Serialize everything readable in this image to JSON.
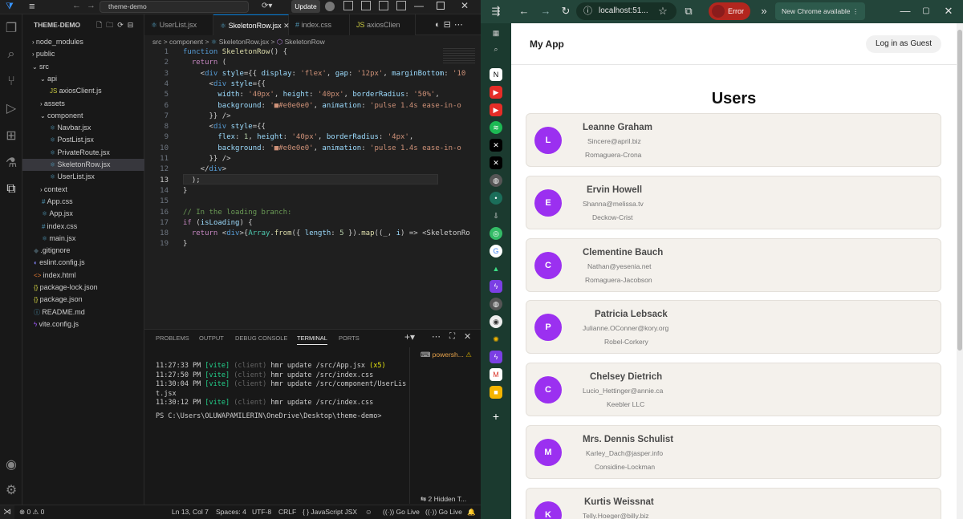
{
  "vscode": {
    "title_search": "theme-demo",
    "update_label": "Update",
    "explorer_header": "THEME-DEMO",
    "tree": [
      {
        "label": "node_modules",
        "kind": "folder",
        "depth": 1,
        "open": false
      },
      {
        "label": "public",
        "kind": "folder",
        "depth": 1,
        "open": false
      },
      {
        "label": "src",
        "kind": "folder",
        "depth": 1,
        "open": true
      },
      {
        "label": "api",
        "kind": "folder",
        "depth": 2,
        "open": true
      },
      {
        "label": "axiosClient.js",
        "kind": "js",
        "depth": 3
      },
      {
        "label": "assets",
        "kind": "folder",
        "depth": 2,
        "open": false
      },
      {
        "label": "component",
        "kind": "folder",
        "depth": 2,
        "open": true
      },
      {
        "label": "Navbar.jsx",
        "kind": "jsx",
        "depth": 3
      },
      {
        "label": "PostList.jsx",
        "kind": "jsx",
        "depth": 3
      },
      {
        "label": "PrivateRoute.jsx",
        "kind": "jsx",
        "depth": 3
      },
      {
        "label": "SkeletonRow.jsx",
        "kind": "jsx",
        "depth": 3,
        "selected": true
      },
      {
        "label": "UserList.jsx",
        "kind": "jsx",
        "depth": 3
      },
      {
        "label": "context",
        "kind": "folder",
        "depth": 2,
        "open": false
      },
      {
        "label": "App.css",
        "kind": "css",
        "depth": 2
      },
      {
        "label": "App.jsx",
        "kind": "jsx",
        "depth": 2
      },
      {
        "label": "index.css",
        "kind": "css",
        "depth": 2
      },
      {
        "label": "main.jsx",
        "kind": "jsx",
        "depth": 2
      },
      {
        "label": ".gitignore",
        "kind": "git",
        "depth": 1
      },
      {
        "label": "eslint.config.js",
        "kind": "eslint",
        "depth": 1
      },
      {
        "label": "index.html",
        "kind": "html",
        "depth": 1
      },
      {
        "label": "package-lock.json",
        "kind": "json",
        "depth": 1
      },
      {
        "label": "package.json",
        "kind": "json",
        "depth": 1
      },
      {
        "label": "README.md",
        "kind": "md",
        "depth": 1
      },
      {
        "label": "vite.config.js",
        "kind": "vite",
        "depth": 1
      }
    ],
    "tabs": [
      {
        "label": "UserList.jsx",
        "active": false
      },
      {
        "label": "SkeletonRow.jsx",
        "active": true
      },
      {
        "label": "index.css",
        "active": false
      },
      {
        "label": "axiosClien",
        "active": false
      }
    ],
    "breadcrumb": [
      "src",
      "component",
      "SkeletonRow.jsx",
      "SkeletonRow"
    ],
    "line_numbers": [
      "1",
      "2",
      "3",
      "4",
      "5",
      "6",
      "7",
      "8",
      "9",
      "10",
      "11",
      "12",
      "13",
      "14",
      "15",
      "16",
      "17",
      "18",
      "19"
    ],
    "code_lines": [
      "function SkeletonRow() {",
      "  return (",
      "    <div style={{ display: 'flex', gap: '12px', marginBottom: '10",
      "      <div style={{",
      "        width: '40px', height: '40px', borderRadius: '50%',",
      "        background: '■#e0e0e0', animation: 'pulse 1.4s ease-in-o",
      "      }} />",
      "      <div style={{",
      "        flex: 1, height: '40px', borderRadius: '4px',",
      "        background: '■#e0e0e0', animation: 'pulse 1.4s ease-in-o",
      "      }} />",
      "    </div>",
      "  );",
      "}",
      "",
      "// In the loading branch:",
      "if (isLoading) {",
      "  return <div>{Array.from({ length: 5 }).map((_, i) => <SkeletonRo",
      "}"
    ],
    "panel_tabs": [
      "PROBLEMS",
      "OUTPUT",
      "DEBUG CONSOLE",
      "TERMINAL",
      "PORTS"
    ],
    "terminal_shell": "powersh...",
    "terminal_lines": [
      {
        "time": "11:27:33 PM",
        "tag": "[vite]",
        "src": "(client)",
        "msg": "hmr update /src/App.jsx",
        "extra": "(x5)"
      },
      {
        "time": "11:27:50 PM",
        "tag": "[vite]",
        "src": "(client)",
        "msg": "hmr update /src/index.css",
        "extra": ""
      },
      {
        "time": "11:30:04 PM",
        "tag": "[vite]",
        "src": "(client)",
        "msg": "hmr update /src/component/UserLis",
        "extra": ""
      },
      {
        "time": "",
        "tag": "",
        "src": "",
        "msg": "t.jsx",
        "extra": ""
      },
      {
        "time": "11:30:12 PM",
        "tag": "[vite]",
        "src": "(client)",
        "msg": "hmr update /src/index.css",
        "extra": ""
      }
    ],
    "prompt": "PS C:\\Users\\OLUWAPAMILERIN\\OneDrive\\Desktop\\theme-demo>",
    "hidden_terminals": "2 Hidden T...",
    "status": {
      "errors": "0",
      "warnings": "0",
      "position": "Ln 13, Col 7",
      "spaces": "Spaces: 4",
      "encoding": "UTF-8",
      "eol": "CRLF",
      "language": "JavaScript JSX",
      "golive1": "Go Live",
      "golive2": "Go Live"
    }
  },
  "chrome": {
    "url": "localhost:51...",
    "error_label": "Error",
    "update_label": "New Chrome available",
    "app_title": "My App",
    "login_label": "Log in as Guest",
    "page_heading": "Users",
    "users": [
      {
        "initial": "L",
        "name": "Leanne Graham",
        "email": "Sincere@april.biz",
        "company": "Romaguera-Crona"
      },
      {
        "initial": "E",
        "name": "Ervin Howell",
        "email": "Shanna@melissa.tv",
        "company": "Deckow-Crist"
      },
      {
        "initial": "C",
        "name": "Clementine Bauch",
        "email": "Nathan@yesenia.net",
        "company": "Romaguera-Jacobson"
      },
      {
        "initial": "P",
        "name": "Patricia Lebsack",
        "email": "Julianne.OConner@kory.org",
        "company": "Robel-Corkery"
      },
      {
        "initial": "C",
        "name": "Chelsey Dietrich",
        "email": "Lucio_Hettinger@annie.ca",
        "company": "Keebler LLC"
      },
      {
        "initial": "M",
        "name": "Mrs. Dennis Schulist",
        "email": "Karley_Dach@jasper.info",
        "company": "Considine-Lockman"
      },
      {
        "initial": "K",
        "name": "Kurtis Weissnat",
        "email": "Telly.Hoeger@billy.biz",
        "company": ""
      }
    ]
  },
  "colors": {
    "avatar": "#9b30f0",
    "accent": "#0078d4",
    "error": "#b3261e"
  }
}
